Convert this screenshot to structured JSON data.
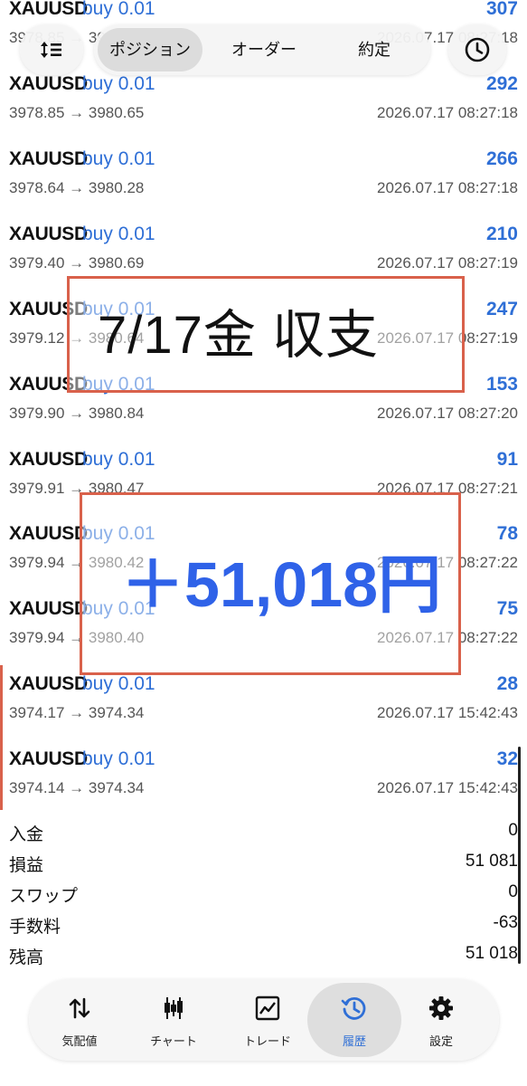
{
  "top_bar": {
    "tabs": [
      "ポジション",
      "オーダー",
      "約定"
    ],
    "active_tab": "ポジション",
    "sort_icon": "sort-icon",
    "history_icon": "clock-icon"
  },
  "deals": [
    {
      "symbol": "XAUUSD",
      "side": "buy 0.01",
      "prices": "3978.85 → 3980.65",
      "profit": "307",
      "time": "2026.07.17 08:27:18"
    },
    {
      "symbol": "XAUUSD",
      "side": "buy 0.01",
      "prices": "3978.85 → 3980.65",
      "profit": "292",
      "time": "2026.07.17 08:27:18"
    },
    {
      "symbol": "XAUUSD",
      "side": "buy 0.01",
      "prices": "3978.64 → 3980.28",
      "profit": "266",
      "time": "2026.07.17 08:27:18"
    },
    {
      "symbol": "XAUUSD",
      "side": "buy 0.01",
      "prices": "3979.40 → 3980.69",
      "profit": "210",
      "time": "2026.07.17 08:27:19"
    },
    {
      "symbol": "XAUUSD",
      "side": "buy 0.01",
      "prices": "3979.12 → 3980.64",
      "profit": "247",
      "time": "2026.07.17 08:27:19"
    },
    {
      "symbol": "XAUUSD",
      "side": "buy 0.01",
      "prices": "3979.90 → 3980.84",
      "profit": "153",
      "time": "2026.07.17 08:27:20"
    },
    {
      "symbol": "XAUUSD",
      "side": "buy 0.01",
      "prices": "3979.91 → 3980.47",
      "profit": "91",
      "time": "2026.07.17 08:27:21"
    },
    {
      "symbol": "XAUUSD",
      "side": "buy 0.01",
      "prices": "3979.94 → 3980.42",
      "profit": "78",
      "time": "2026.07.17 08:27:22"
    },
    {
      "symbol": "XAUUSD",
      "side": "buy 0.01",
      "prices": "3979.94 → 3980.40",
      "profit": "75",
      "time": "2026.07.17 08:27:22"
    },
    {
      "symbol": "XAUUSD",
      "side": "buy 0.01",
      "prices": "3974.17 → 3974.34",
      "profit": "28",
      "time": "2026.07.17 15:42:43"
    },
    {
      "symbol": "XAUUSD",
      "side": "buy 0.01",
      "prices": "3974.14 → 3974.34",
      "profit": "32",
      "time": "2026.07.17 15:42:43"
    }
  ],
  "summary": [
    {
      "label": "入金",
      "value": "0"
    },
    {
      "label": "損益",
      "value": "51 081"
    },
    {
      "label": "スワップ",
      "value": "0"
    },
    {
      "label": "手数料",
      "value": "-63"
    },
    {
      "label": "残高",
      "value": "51 018"
    }
  ],
  "overlay": {
    "title": "7/17金 収支",
    "amount": "＋51,018円",
    "box_color": "#d9614b",
    "amount_color": "#2f62e8"
  },
  "bottom_nav": [
    {
      "label": "気配値",
      "icon": "quotes-arrows-icon"
    },
    {
      "label": "チャート",
      "icon": "candlestick-chart-icon"
    },
    {
      "label": "トレード",
      "icon": "trade-line-chart-icon"
    },
    {
      "label": "履歴",
      "icon": "history-clock-icon"
    },
    {
      "label": "設定",
      "icon": "gear-icon"
    }
  ],
  "active_nav": "履歴",
  "colors": {
    "accent": "#2f6fd6",
    "text": "#111111",
    "muted": "#555555"
  }
}
